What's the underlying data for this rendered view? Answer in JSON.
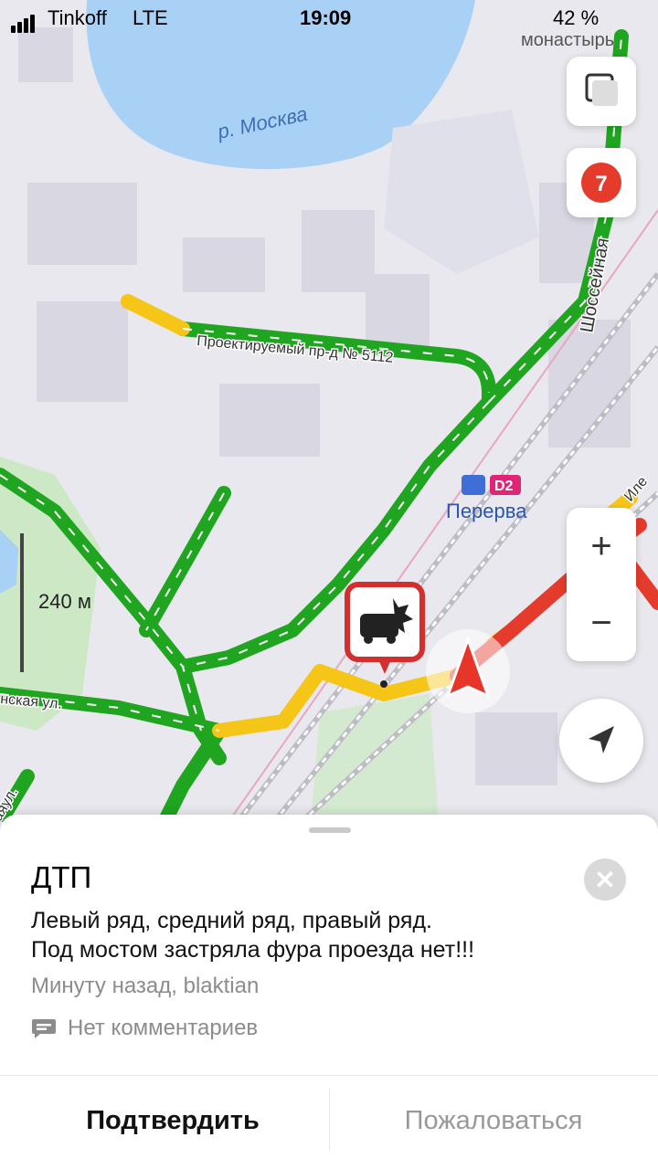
{
  "status": {
    "carrier": "Tinkoff",
    "network": "LTE",
    "time": "19:09",
    "battery": "42 %"
  },
  "map": {
    "labels": {
      "river": "р. Москва",
      "monastery": "монастырь",
      "street_project": "Проектируемый пр-д № 5112",
      "street_shosseynaya": "Шоссейная",
      "station": "Перерва",
      "station_badge": "D2",
      "street_left": "нская ул.",
      "street_left2": "аяул.",
      "street_right": "Иле"
    },
    "layers_badge": "7",
    "zoom_in": "+",
    "zoom_out": "−",
    "scale": "240 м",
    "colors": {
      "traffic_free": "#1fa51f",
      "traffic_slow": "#f5c518",
      "traffic_jam": "#e53b2c",
      "water": "#a9d1f5",
      "incident": "#d32f2f"
    }
  },
  "incident": {
    "title": "ДТП",
    "description_line1": "Левый ряд, средний ряд, правый ряд.",
    "description_line2": "Под мостом застряла фура проезда нет!!!",
    "meta": "Минуту назад, blaktian",
    "comments": "Нет комментариев",
    "confirm_label": "Подтвердить",
    "report_label": "Пожаловаться"
  }
}
